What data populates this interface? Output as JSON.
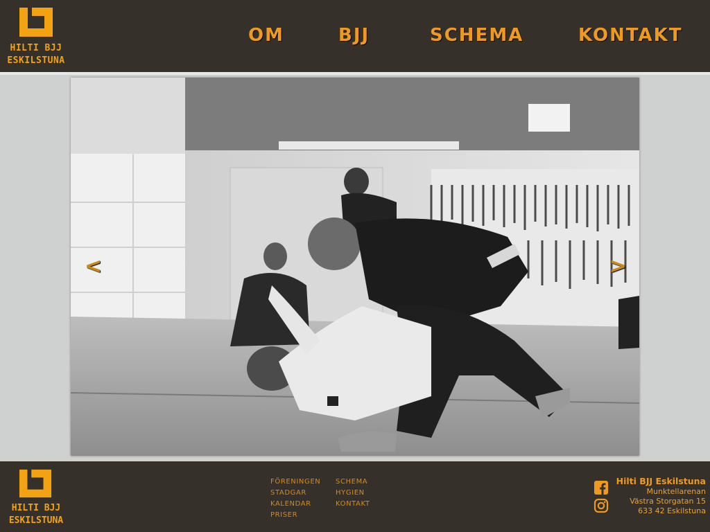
{
  "brand": {
    "line1": "HILTI BJJ",
    "line2": "ESKILSTUNA"
  },
  "nav": [
    {
      "label": "OM"
    },
    {
      "label": "BJJ"
    },
    {
      "label": "SCHEMA"
    },
    {
      "label": "KONTAKT"
    }
  ],
  "slider": {
    "prev": "<",
    "next": ">"
  },
  "footer": {
    "col1": [
      {
        "label": "FÖRENINGEN"
      },
      {
        "label": "STADGAR"
      },
      {
        "label": "KALENDAR"
      },
      {
        "label": "PRISER"
      }
    ],
    "col2": [
      {
        "label": "SCHEMA"
      },
      {
        "label": "HYGIEN"
      },
      {
        "label": "KONTAKT"
      }
    ],
    "contact": {
      "name": "Hilti BJJ Eskilstuna",
      "place": "Munktellarenan",
      "street": "Västra Storgatan 15",
      "city": "633 42 Eskilstuna"
    }
  },
  "colors": {
    "accent": "#f3a312",
    "header_bg": "#35302a",
    "page_bg": "#cfd0d0"
  },
  "icons": {
    "facebook": "facebook-icon",
    "instagram": "instagram-icon",
    "prev": "chevron-left-icon",
    "next": "chevron-right-icon"
  }
}
